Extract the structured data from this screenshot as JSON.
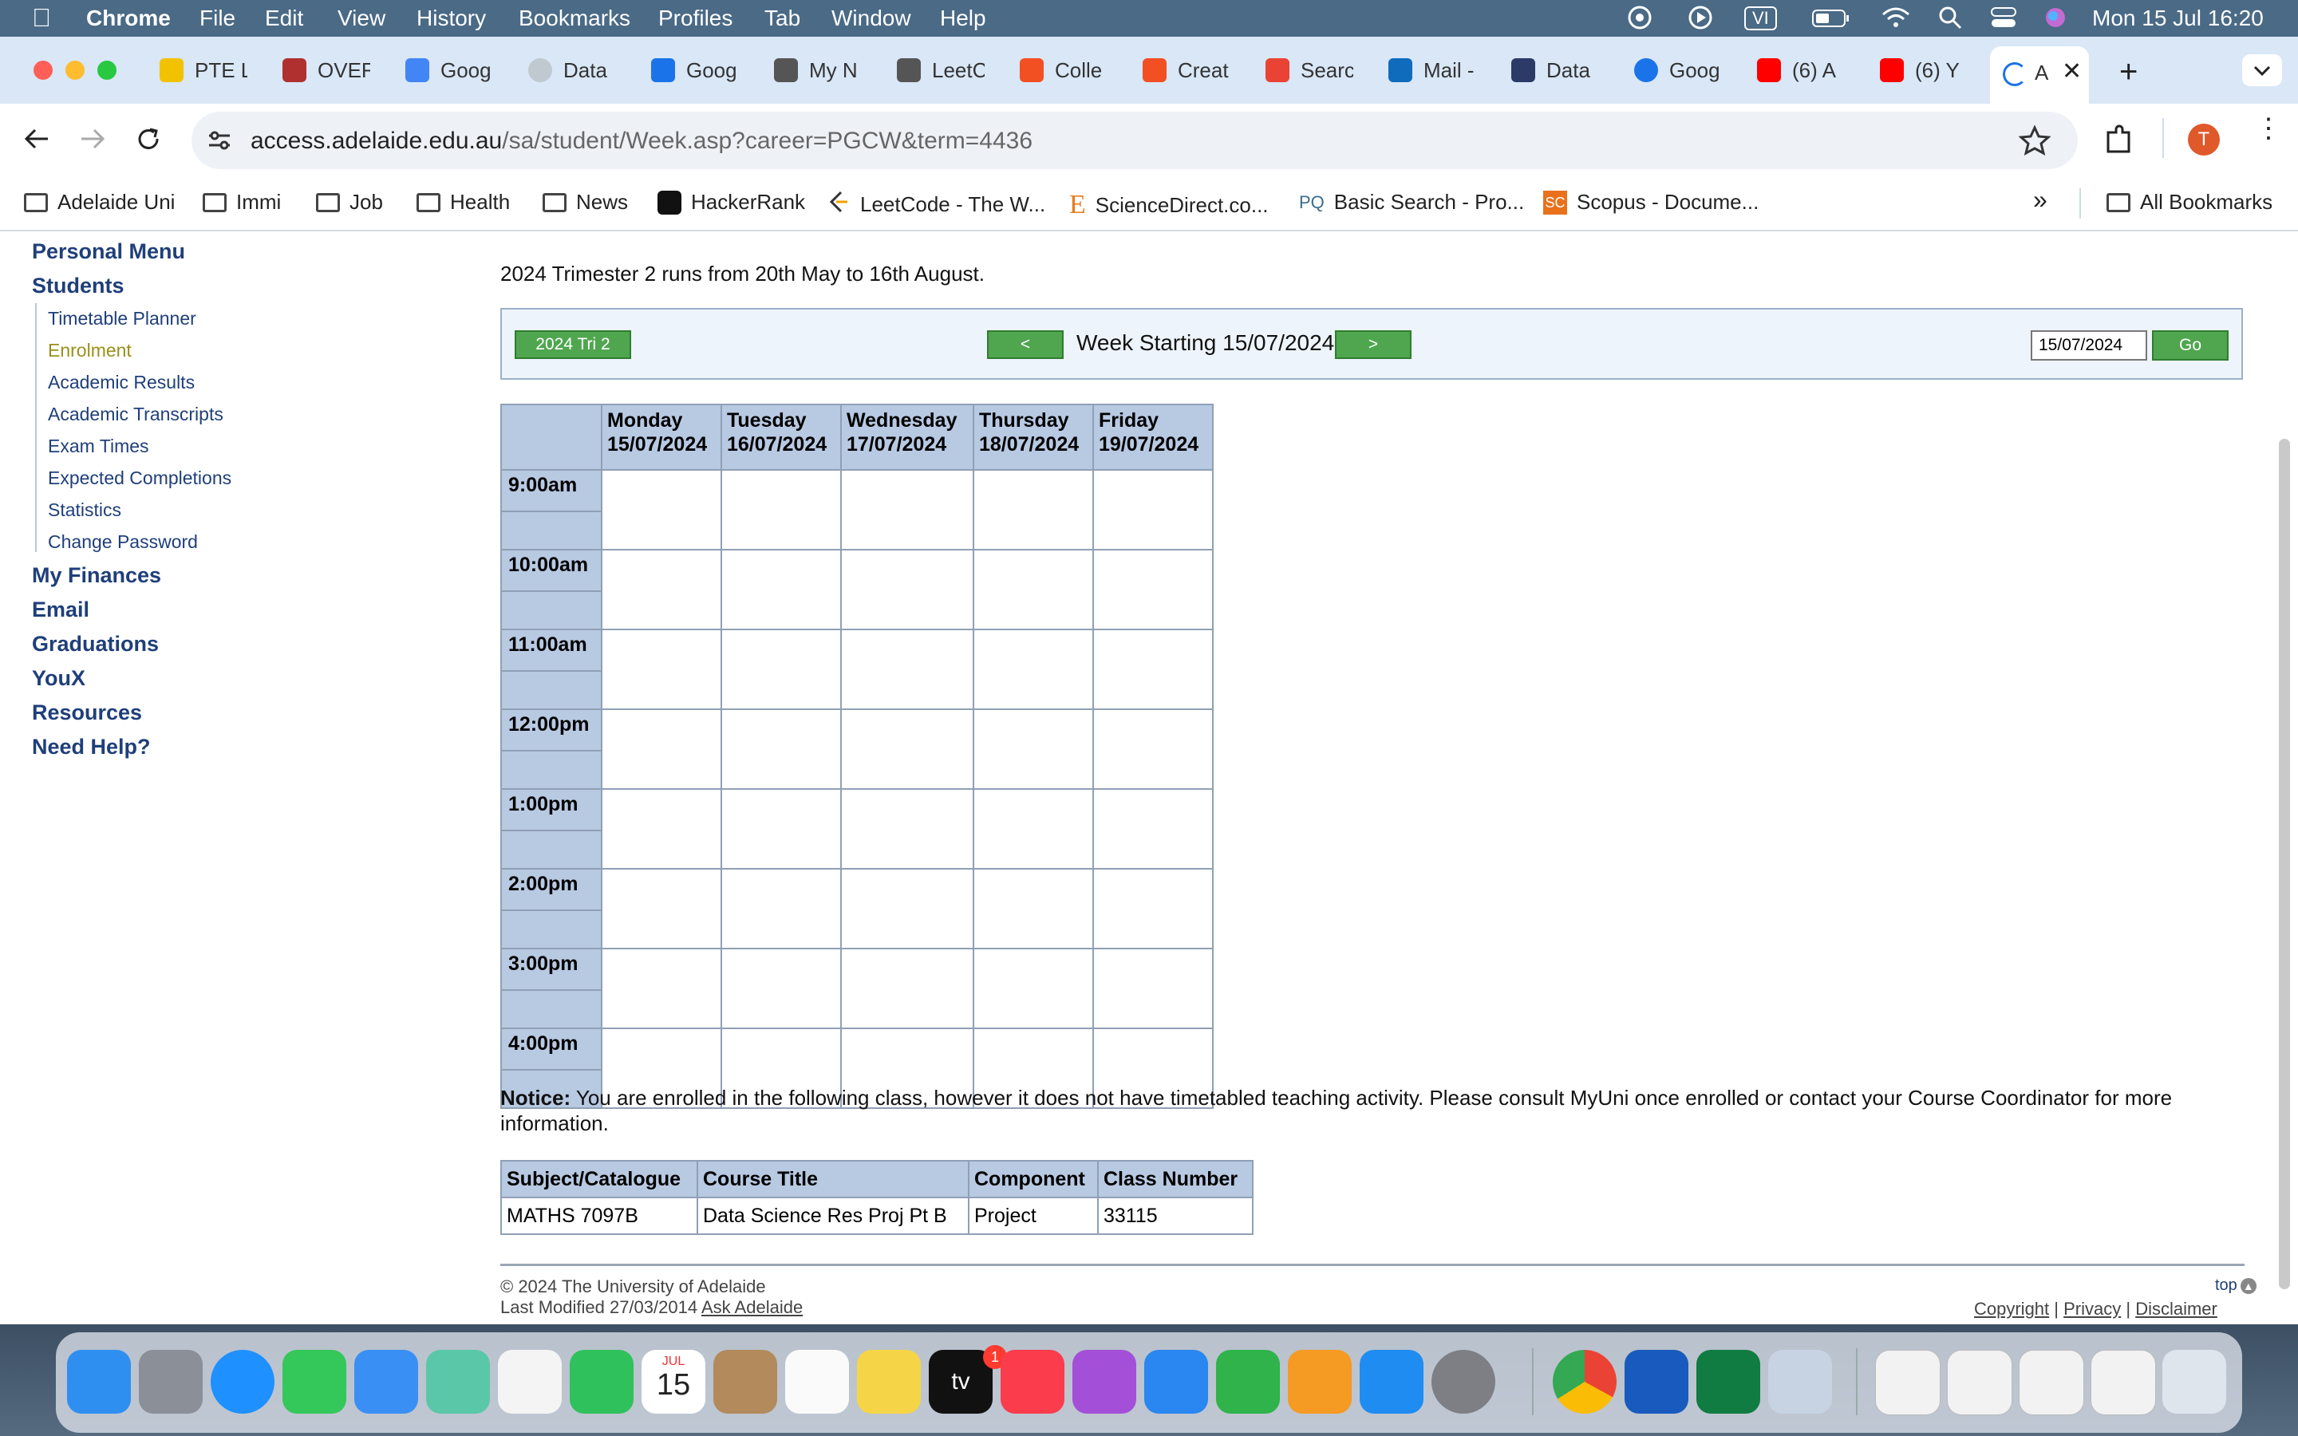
{
  "menubar": {
    "app": "Chrome",
    "items": [
      "File",
      "Edit",
      "View",
      "History",
      "Bookmarks",
      "Profiles",
      "Tab",
      "Window",
      "Help"
    ],
    "input_badge": "VI",
    "clock": "Mon 15 Jul  16:20"
  },
  "tabs": [
    {
      "label": "PTE L",
      "color": "#f2c200"
    },
    {
      "label": "OVEF",
      "color": "#b03030"
    },
    {
      "label": "Goog",
      "color": "#4285f4"
    },
    {
      "label": "Data",
      "color": "#c0c8d0"
    },
    {
      "label": "Goog",
      "color": "#1a73e8"
    },
    {
      "label": "My N",
      "color": "#555555"
    },
    {
      "label": "LeetC",
      "color": "#555555"
    },
    {
      "label": "Colle",
      "color": "#f25022"
    },
    {
      "label": "Creat",
      "color": "#f25022"
    },
    {
      "label": "Searc",
      "color": "#ea4335"
    },
    {
      "label": "Mail -",
      "color": "#0f6cbd"
    },
    {
      "label": "Data",
      "color": "#2b3a67"
    },
    {
      "label": "Goog",
      "color": "#1a73e8"
    },
    {
      "label": "(6) A",
      "color": "#ff0000"
    },
    {
      "label": "(6) Y",
      "color": "#ff0000"
    },
    {
      "label": "A",
      "color": "#1a73e8",
      "active": true
    }
  ],
  "toolbar": {
    "url_host": "access.adelaide.edu.au",
    "url_path": "/sa/student/Week.asp?career=PGCW&term=4436",
    "profile_initial": "T"
  },
  "bookmarks": [
    {
      "label": "Adelaide Uni",
      "icon": "folder-icon"
    },
    {
      "label": "Immi",
      "icon": "folder-icon"
    },
    {
      "label": "Job",
      "icon": "folder-icon"
    },
    {
      "label": "Health",
      "icon": "folder-icon"
    },
    {
      "label": "News",
      "icon": "folder-icon"
    },
    {
      "label": "HackerRank",
      "icon": "hackerrank-icon"
    },
    {
      "label": "LeetCode - The W...",
      "icon": "leetcode-icon"
    },
    {
      "label": "ScienceDirect.co...",
      "icon": "sciencedirect-icon"
    },
    {
      "label": "Basic Search - Pro...",
      "icon": "proquest-icon"
    },
    {
      "label": "Scopus - Docume...",
      "icon": "scopus-icon"
    }
  ],
  "all_bookmarks": "All Bookmarks",
  "sidebar": {
    "personal_menu": "Personal Menu",
    "students": "Students",
    "student_items": [
      "Timetable Planner",
      "Enrolment",
      "Academic Results",
      "Academic Transcripts",
      "Exam Times",
      "Expected Completions",
      "Statistics",
      "Change Password"
    ],
    "active_item": "Enrolment",
    "sections": [
      "My Finances",
      "Email",
      "Graduations",
      "YouX",
      "Resources",
      "Need Help?"
    ]
  },
  "main": {
    "trimester_text": "2024 Trimester 2 runs from 20th May to 16th August.",
    "term_button": "2024 Tri 2",
    "prev_button": "<",
    "week_label": "Week Starting 15/07/2024",
    "next_button": ">",
    "date_value": "15/07/2024",
    "go_button": "Go",
    "days": [
      {
        "name": "Monday",
        "date": "15/07/2024"
      },
      {
        "name": "Tuesday",
        "date": "16/07/2024"
      },
      {
        "name": "Wednesday",
        "date": "17/07/2024"
      },
      {
        "name": "Thursday",
        "date": "18/07/2024"
      },
      {
        "name": "Friday",
        "date": "19/07/2024"
      }
    ],
    "times": [
      "9:00am",
      "10:00am",
      "11:00am",
      "12:00pm",
      "1:00pm",
      "2:00pm",
      "3:00pm",
      "4:00pm"
    ],
    "notice_label": "Notice:",
    "notice_text": " You are enrolled in the following class, however it does not have timetabled teaching activity. Please consult MyUni once enrolled or contact your Course Coordinator for more information.",
    "class_table": {
      "headers": [
        "Subject/Catalogue",
        "Course Title",
        "Component",
        "Class Number"
      ],
      "rows": [
        [
          "MATHS 7097B",
          "Data Science Res Proj Pt B",
          "Project",
          "33115"
        ]
      ]
    }
  },
  "footer": {
    "copyright": "© 2024 The University of Adelaide",
    "last_modified": "Last Modified 27/03/2014",
    "ask": "Ask Adelaide",
    "top": "top",
    "links": [
      "Copyright",
      "Privacy",
      "Disclaimer"
    ]
  },
  "dock": {
    "calendar_month": "JUL",
    "calendar_day": "15",
    "tv_label": "tv",
    "tv_badge": "1"
  }
}
